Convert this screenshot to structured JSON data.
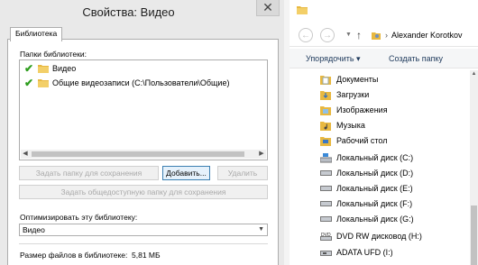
{
  "dialog": {
    "title": "Свойства: Видео",
    "close_glyph": "✕",
    "tab_label": "Библиотека",
    "folders_label": "Папки библиотеки:",
    "folders": [
      {
        "name": "Видео",
        "icon": "green-check-icon"
      },
      {
        "name": "Общие видеозаписи (C:\\Пользователи\\Общие)",
        "icon": "shared-check-icon"
      }
    ],
    "buttons": {
      "set_save": "Задать папку для сохранения",
      "add": "Добавить...",
      "remove": "Удалить",
      "set_public_save": "Задать общедоступную папку для сохранения"
    },
    "optimize_label": "Оптимизировать эту библиотеку:",
    "optimize_value": "Видео",
    "size_label": "Размер файлов в библиотеке:",
    "size_value": "5,81 МБ"
  },
  "explorer": {
    "address": "Alexander Korotkov",
    "toolbar": {
      "organize": "Упорядочить ▾",
      "new_folder": "Создать папку"
    },
    "nav_items": [
      {
        "label": "Документы",
        "icon": "folder-documents-icon"
      },
      {
        "label": "Загрузки",
        "icon": "folder-downloads-icon"
      },
      {
        "label": "Изображения",
        "icon": "folder-pictures-icon"
      },
      {
        "label": "Музыка",
        "icon": "folder-music-icon"
      },
      {
        "label": "Рабочий стол",
        "icon": "folder-desktop-icon"
      },
      {
        "label": "Локальный диск (C:)",
        "icon": "drive-c-icon"
      },
      {
        "label": "Локальный диск (D:)",
        "icon": "drive-icon"
      },
      {
        "label": "Локальный диск (E:)",
        "icon": "drive-icon"
      },
      {
        "label": "Локальный диск (F:)",
        "icon": "drive-icon"
      },
      {
        "label": "Локальный диск (G:)",
        "icon": "drive-icon"
      },
      {
        "label": "DVD RW дисковод (H:)",
        "icon": "dvd-drive-icon"
      },
      {
        "label": "ADATA UFD (I:)",
        "icon": "usb-drive-icon"
      }
    ]
  },
  "colors": {
    "folder": "#e8b840",
    "check": "#2f9e1f",
    "toolbar_text": "#1e395b",
    "active_button_border": "#3c7fb1"
  }
}
